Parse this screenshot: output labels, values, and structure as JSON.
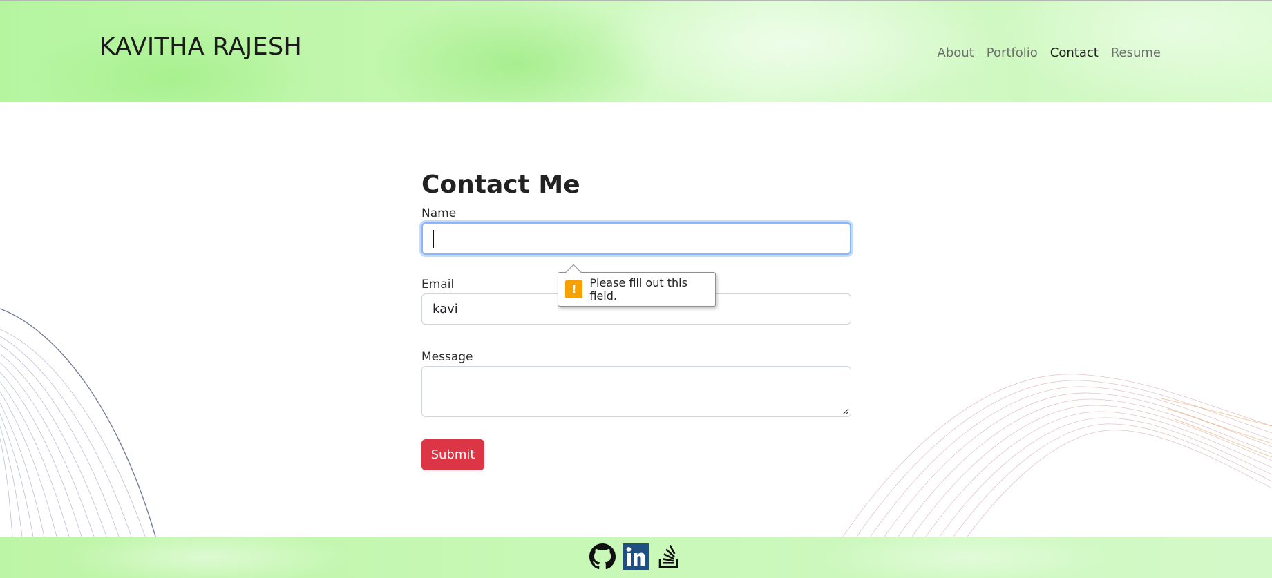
{
  "header": {
    "brand": "KAVITHA RAJESH",
    "nav": [
      "About",
      "Portfolio",
      "Contact",
      "Resume"
    ],
    "active_nav": "Contact"
  },
  "contact": {
    "title": "Contact Me",
    "name_label": "Name",
    "name_value": "",
    "email_label": "Email",
    "email_value": "kavi",
    "message_label": "Message",
    "message_value": "",
    "submit_label": "Submit"
  },
  "tooltip": {
    "text": "Please fill out this field.",
    "icon": "warning-icon"
  },
  "footer": {
    "icons": [
      "github-icon",
      "linkedin-icon",
      "stackoverflow-icon"
    ]
  },
  "colors": {
    "header_green": "#b5f5a0",
    "submit_red": "#dc3545",
    "focus_blue": "#86b7fe",
    "warning_orange": "#f6a100",
    "linkedin_blue": "#1f4f80"
  }
}
